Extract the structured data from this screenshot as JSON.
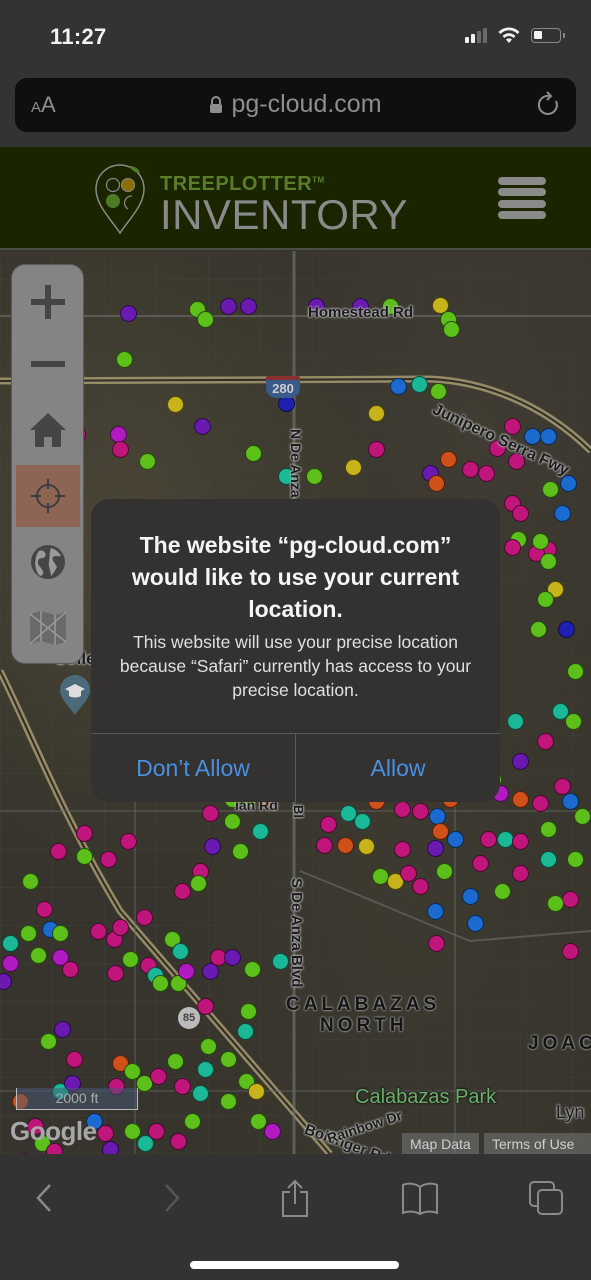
{
  "status_bar": {
    "time": "11:27",
    "signal_bars_active": 2,
    "signal_bars_total": 4,
    "wifi_icon": "wifi-icon",
    "battery_level_percent": 25
  },
  "url_bar": {
    "text_size_label": "AA",
    "lock_icon": "lock-icon",
    "url": "pg-cloud.com",
    "reload_icon": "reload-icon"
  },
  "site_header": {
    "brand_small": "TREEPLOTTER",
    "trademark": "TM",
    "brand_big": "INVENTORY",
    "menu_icon": "hamburger-menu-icon",
    "colors": {
      "background": "#1a2500",
      "brand_green": "#5a7d2a",
      "logo_gold": "#8a7000"
    }
  },
  "map": {
    "labels": {
      "homestead": "Homestead Rd",
      "junipero": "Junipero Serra Fwy",
      "highway_280": "280",
      "n_de_anza": "N De Anza",
      "college": "College",
      "mariani": "ian Rd",
      "s_de_anza": "S De Anza Blvd",
      "bollinger": "Bollinger Rd",
      "calabazas_north_1": "CALABAZAS",
      "calabazas_north_2": "NORTH",
      "joaquin": "JOAC",
      "calabazas_park": "Calabazas Park",
      "lynbrook": "Lyn",
      "rainbow": "Rainbow Dr",
      "highway_85": "85",
      "blvd_partial": "Bl"
    },
    "scale_label": "2000 ft",
    "google_label": "Google",
    "map_data_label": "Map Data",
    "terms_label": "Terms of Use",
    "marker_colors": {
      "magenta": "#c0157a",
      "green": "#5cbf1a",
      "purple": "#6a1ab0",
      "blue": "#1a6ad0",
      "teal": "#1ab896",
      "orange": "#d0501a",
      "yellow": "#c8b41a",
      "cyan": "#1ab0d0",
      "violet": "#b01ac0",
      "navy": "#2020b0"
    }
  },
  "map_controls": {
    "items": [
      {
        "name": "zoom-in",
        "icon": "plus-icon"
      },
      {
        "name": "zoom-out",
        "icon": "minus-icon"
      },
      {
        "name": "home",
        "icon": "home-icon"
      },
      {
        "name": "locate",
        "icon": "crosshair-icon",
        "active": true
      },
      {
        "name": "globe",
        "icon": "globe-icon"
      },
      {
        "name": "basemap",
        "icon": "map-icon"
      }
    ]
  },
  "alert": {
    "title": "The website “pg-cloud.com” would like to use your current location.",
    "message": "This website will use your precise location because “Safari” currently has access to your precise location.",
    "deny_label": "Don’t Allow",
    "allow_label": "Allow",
    "button_color": "#4a90e2"
  },
  "toolbar": {
    "back_icon": "back-chevron-icon",
    "forward_icon": "forward-chevron-icon",
    "share_icon": "share-icon",
    "bookmarks_icon": "bookmarks-icon",
    "tabs_icon": "tabs-icon"
  }
}
